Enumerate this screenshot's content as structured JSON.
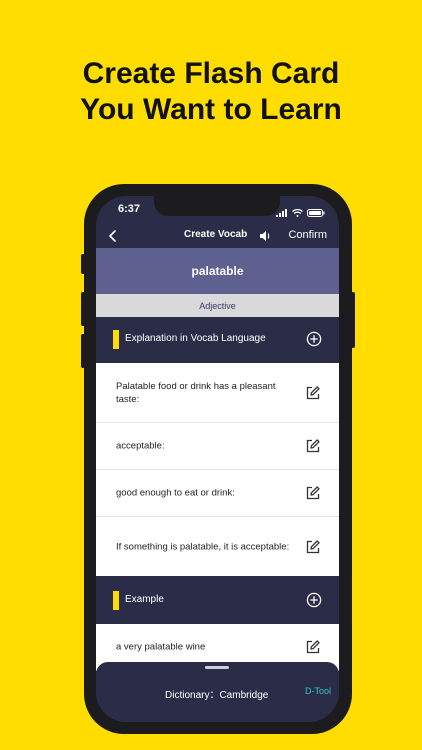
{
  "headline": {
    "line1": "Create Flash Card",
    "line2": "You Want to Learn"
  },
  "status_bar": {
    "time": "6:37"
  },
  "nav": {
    "title": "Create Vocab",
    "confirm_label": "Confirm"
  },
  "word": {
    "text": "palatable",
    "part_of_speech": "Adjective"
  },
  "explanation_section": {
    "label": "Explanation in Vocab Language",
    "items": [
      {
        "text": "Palatable food or drink has a pleasant taste:"
      },
      {
        "text": "acceptable:"
      },
      {
        "text": "good enough to eat or drink:"
      },
      {
        "text": "If something is palatable, it is acceptable:"
      }
    ]
  },
  "example_section": {
    "label": "Example",
    "items": [
      {
        "text": "a very palatable wine"
      }
    ]
  },
  "bottom_sheet": {
    "dictionary_label": "Dictionary：Cambridge",
    "tool_label": "D-Tool"
  },
  "colors": {
    "background": "#FFDD00",
    "screen_dark": "#2B2D48",
    "word_banner": "#5E6090",
    "pos_bar": "#D9D9DB",
    "accent": "#FFDD00",
    "dtool": "#2DC6C6"
  },
  "icons": [
    "back-chevron-icon",
    "speaker-icon",
    "plus-circle-icon",
    "edit-icon",
    "wifi-icon",
    "battery-icon"
  ]
}
